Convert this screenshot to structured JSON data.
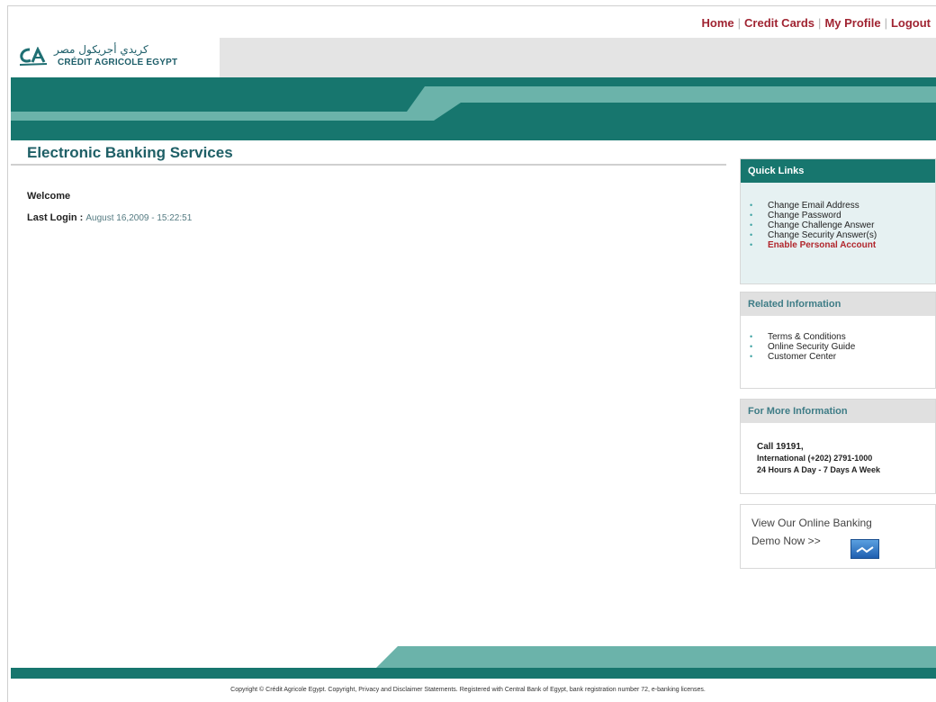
{
  "topnav": {
    "items": [
      "Home",
      "Credit Cards",
      "My Profile",
      "Logout"
    ],
    "separator": "|"
  },
  "brand": {
    "arabic_name": "كريدي أجريكول مصر",
    "latin_name": "CRÉDIT AGRICOLE EGYPT",
    "colors": {
      "teal": "#17766e",
      "light_teal": "#6bb3aa",
      "red": "#a02432"
    }
  },
  "page": {
    "title": "Electronic Banking Services",
    "welcome": "Welcome",
    "last_login_label": "Last Login :",
    "last_login_value": "August 16,2009 - 15:22:51"
  },
  "sidebar": {
    "quick_links": {
      "heading": "Quick Links",
      "items": [
        "Change Email Address",
        "Change Password",
        "Change Challenge Answer",
        "Change Security Answer(s)",
        "Enable Personal Account"
      ]
    },
    "related": {
      "heading": "Related Information",
      "items": [
        "Terms & Conditions",
        "Online Security Guide",
        "Customer Center"
      ]
    },
    "more_info": {
      "heading": "For More Information",
      "lines": [
        "Call 19191,",
        "International (+202) 2791-1000",
        "24 Hours A Day - 7 Days A Week"
      ]
    },
    "demo": {
      "line1": "View Our Online Banking",
      "line2": "Demo Now >>",
      "icon": "demo-play-icon"
    }
  },
  "footer": {
    "copyright": "Copyright © Crédit Agricole Egypt. Copyright, Privacy and Disclaimer Statements. Registered with Central Bank of Egypt, bank registration number 72, e-banking licenses."
  }
}
